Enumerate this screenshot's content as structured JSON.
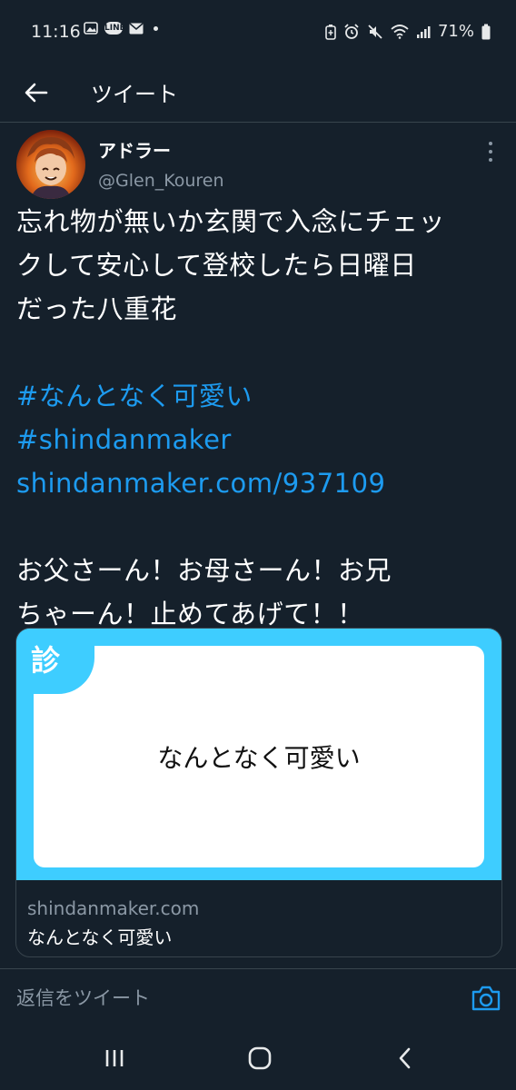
{
  "status_bar": {
    "time": "11:16",
    "line_badge": "LINE",
    "battery": "71%"
  },
  "header": {
    "title": "ツイート"
  },
  "tweet": {
    "display_name": "アドラー",
    "handle": "@Glen_Kouren",
    "lines": [
      "忘れ物が無いか玄関で入念にチェッ",
      "クして安心して登校したら日曜日",
      "だった八重花"
    ],
    "hashtag1": "#なんとなく可愛い",
    "hashtag2": "#shindanmaker",
    "link": "shindanmaker.com/937109",
    "lines2": [
      "お父さーん！お母さーん！お兄",
      "ちゃーん！止めてあげて！！"
    ]
  },
  "card": {
    "badge": "診",
    "image_text": "なんとなく可愛い",
    "domain": "shindanmaker.com",
    "title": "なんとなく可愛い",
    "accent_color": "#3ecdff"
  },
  "reply": {
    "placeholder": "返信をツイート"
  },
  "colors": {
    "background": "#15202b",
    "link": "#1d9bf0",
    "secondary_text": "#8b98a5"
  }
}
